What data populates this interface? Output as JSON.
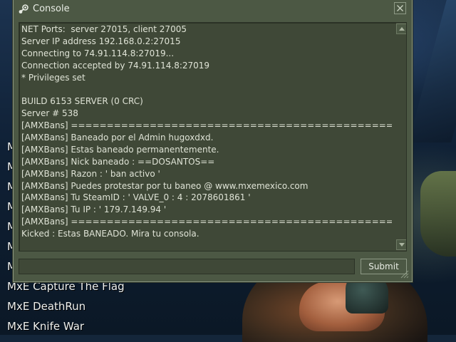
{
  "window": {
    "title": "Console",
    "icon": "steam-icon"
  },
  "console": {
    "lines": [
      "NET Ports:  server 27015, client 27005",
      "Server IP address 192.168.0.2:27015",
      "Connecting to 74.91.114.8:27019...",
      "Connection accepted by 74.91.114.8:27019",
      "* Privileges set",
      "",
      "BUILD 6153 SERVER (0 CRC)",
      "Server # 538",
      "[AMXBans] ==============================================",
      "[AMXBans] Baneado por el Admin hugoxdxd.",
      "[AMXBans] Estas baneado permanentemente.",
      "[AMXBans] Nick baneado : ==DOSANTOS==",
      "[AMXBans] Razon : ' ban activo '",
      "[AMXBans] Puedes protestar por tu baneo @ www.mxemexico.com",
      "[AMXBans] Tu SteamID : ' VALVE_0 : 4 : 2078601861 '",
      "[AMXBans] Tu IP : ' 179.7.149.94 '",
      "[AMXBans] ==============================================",
      "Kicked : Estas BANEADO. Mira tu consola."
    ]
  },
  "command": {
    "value": "",
    "placeholder": "",
    "submit_label": "Submit"
  },
  "background_menu": {
    "partial_items": [
      "M",
      "M",
      "M",
      "M",
      "M",
      "M",
      "M",
      "M"
    ],
    "items": [
      "MxE Capture The Flag",
      "MxE DeathRun",
      "MxE Knife War"
    ]
  },
  "colors": {
    "window_bg": "#4c5844",
    "log_bg": "#3f4837",
    "text": "#dfe3d6"
  }
}
